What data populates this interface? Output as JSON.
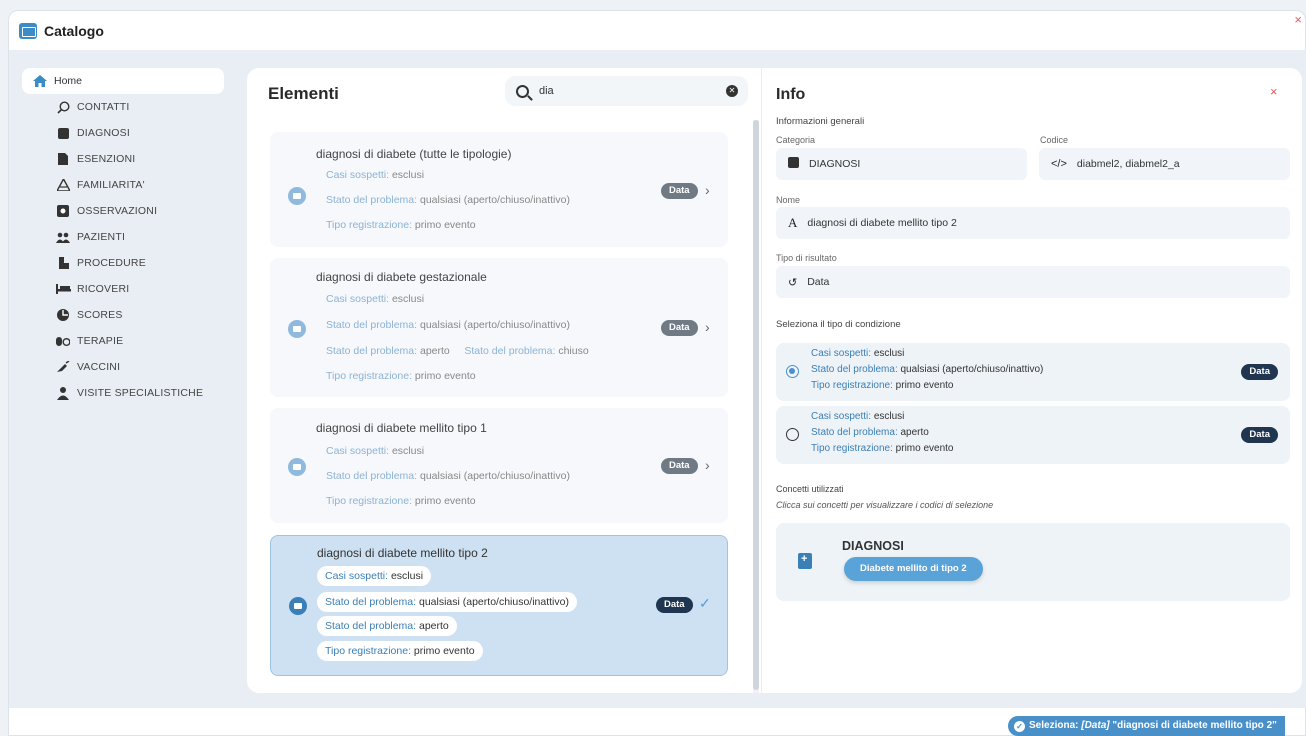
{
  "app": {
    "title": "Catalogo",
    "close": "×"
  },
  "sidebar": {
    "home": "Home",
    "items": [
      "CONTATTI",
      "DIAGNOSI",
      "ESENZIONI",
      "FAMILIARITA'",
      "OSSERVAZIONI",
      "PAZIENTI",
      "PROCEDURE",
      "RICOVERI",
      "SCORES",
      "TERAPIE",
      "VACCINI",
      "VISITE SPECIALISTICHE"
    ]
  },
  "elements": {
    "title": "Elementi",
    "search_value": "dia",
    "cards": [
      {
        "title": "diagnosi di diabete (tutte le tipologie)",
        "l1k": "Casi sospetti:",
        "l1v": "esclusi",
        "l2k": "Stato del problema:",
        "l2v": "qualsiasi (aperto/chiuso/inattivo)",
        "l3k": "Tipo registrazione:",
        "l3v": "primo evento",
        "badge": "Data"
      },
      {
        "title": "diagnosi di diabete gestazionale",
        "l1k": "Casi sospetti:",
        "l1v": "esclusi",
        "l2k": "Stato del problema:",
        "l2v": "qualsiasi (aperto/chiuso/inattivo)",
        "l3ak": "Stato del problema:",
        "l3av": "aperto",
        "l3bk": "Stato del problema:",
        "l3bv": "chiuso",
        "l4k": "Tipo registrazione:",
        "l4v": "primo evento",
        "badge": "Data"
      },
      {
        "title": "diagnosi di diabete mellito tipo 1",
        "l1k": "Casi sospetti:",
        "l1v": "esclusi",
        "l2k": "Stato del problema:",
        "l2v": "qualsiasi (aperto/chiuso/inattivo)",
        "l3k": "Tipo registrazione:",
        "l3v": "primo evento",
        "badge": "Data"
      },
      {
        "title": "diagnosi di diabete mellito tipo 2",
        "l1k": "Casi sospetti:",
        "l1v": "esclusi",
        "l2k": "Stato del problema:",
        "l2v": "qualsiasi (aperto/chiuso/inattivo)",
        "l3k": "Stato del problema:",
        "l3v": "aperto",
        "l4k": "Tipo registrazione:",
        "l4v": "primo evento",
        "badge": "Data",
        "selected": true
      }
    ]
  },
  "info": {
    "title": "Info",
    "general": "Informazioni generali",
    "categoria_label": "Categoria",
    "categoria": "DIAGNOSI",
    "codice_label": "Codice",
    "codice": "diabmel2, diabmel2_a",
    "nome_label": "Nome",
    "nome": "diagnosi di diabete mellito tipo 2",
    "tipo_label": "Tipo di risultato",
    "tipo": "Data",
    "cond_label": "Seleziona il tipo di condizione",
    "options": [
      {
        "l1k": "Casi sospetti:",
        "l1v": "esclusi",
        "l2k": "Stato del problema:",
        "l2v": "qualsiasi (aperto/chiuso/inattivo)",
        "l3k": "Tipo registrazione:",
        "l3v": "primo evento",
        "badge": "Data",
        "selected": true
      },
      {
        "l1k": "Casi sospetti:",
        "l1v": "esclusi",
        "l2k": "Stato del problema:",
        "l2v": "aperto",
        "l3k": "Tipo registrazione:",
        "l3v": "primo evento",
        "badge": "Data",
        "selected": false
      }
    ],
    "concepts_label": "Concetti utilizzati",
    "concepts_hint": "Clicca sui concetti per visualizzare i codici di selezione",
    "concept_name": "DIAGNOSI",
    "concept_button": "Diabete mellito di tipo 2"
  },
  "selection": {
    "prefix": "Seleziona:",
    "type": "[Data]",
    "value": "\"diagnosi di diabete mellito tipo 2\""
  },
  "colors": {
    "accent": "#3b8bc7",
    "badge_dark": "#1f3550",
    "close": "#e06060"
  }
}
